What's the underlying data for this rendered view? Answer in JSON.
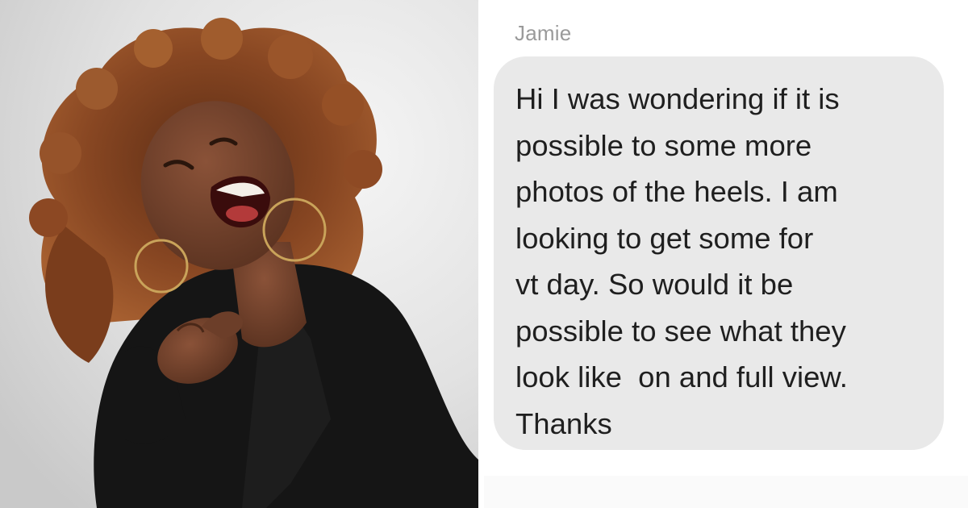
{
  "left_photo": {
    "description_icon": "laughing-woman-pointing-photo",
    "colors": {
      "background": "#e3e3e3",
      "hair": "#8a4a22",
      "skin": "#6b3f2b",
      "clothing": "#161616"
    }
  },
  "chat": {
    "sender": "Jamie",
    "message_lines": [
      "Hi I was wondering if it is",
      "possible to some more",
      "photos of the heels. I am",
      "looking to get some for",
      "vt day. So would it be",
      "possible to see what they",
      "look like  on and full view.",
      "Thanks"
    ],
    "colors": {
      "bubble": "#e9e9e9",
      "text": "#1f1f1f",
      "sender": "#9a9a9a"
    }
  }
}
